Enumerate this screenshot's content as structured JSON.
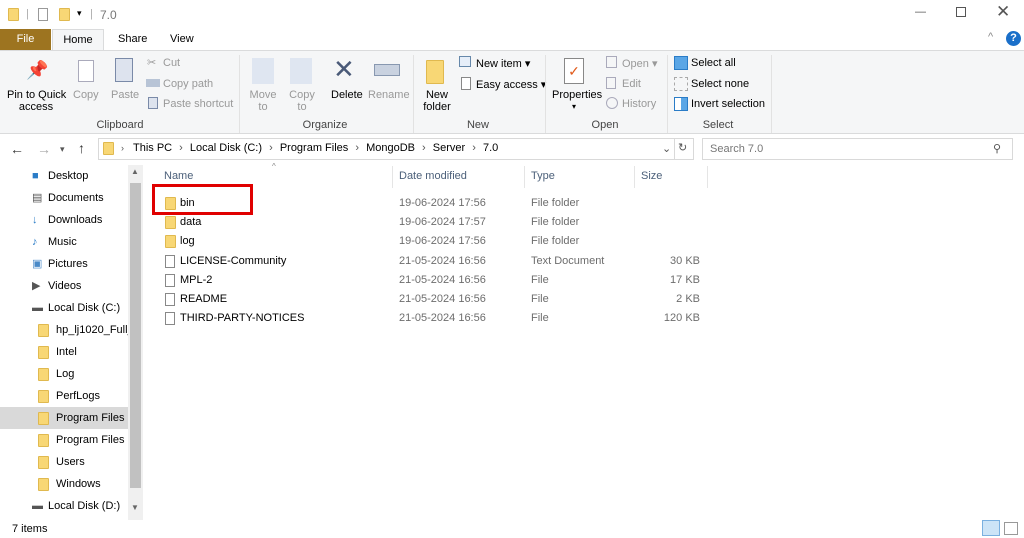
{
  "window": {
    "title": "7.0",
    "controls": [
      "minimize",
      "maximize",
      "close"
    ]
  },
  "tabs": [
    {
      "label": "File",
      "active": false
    },
    {
      "label": "Home",
      "active": true
    },
    {
      "label": "Share"
    },
    {
      "label": "View"
    }
  ],
  "ribbon": {
    "clipboard": {
      "pin": "Pin to Quick access",
      "pin1": "Pin to Quick",
      "pin2": "access",
      "copy": "Copy",
      "paste": "Paste",
      "cut": "Cut",
      "copy_path": "Copy path",
      "paste_shortcut": "Paste shortcut",
      "label": "Clipboard"
    },
    "organize": {
      "move1": "Move",
      "move2": "to",
      "copy1": "Copy",
      "copy2": "to",
      "delete": "Delete",
      "rename": "Rename",
      "label": "Organize"
    },
    "new": {
      "folder1": "New",
      "folder2": "folder",
      "new_item": "New item",
      "easy_access": "Easy access",
      "label": "New"
    },
    "open": {
      "properties": "Properties",
      "open": "Open",
      "edit": "Edit",
      "history": "History",
      "label": "Open"
    },
    "select": {
      "all": "Select all",
      "none": "Select none",
      "invert": "Invert selection",
      "label": "Select"
    }
  },
  "breadcrumb": [
    "This PC",
    "Local Disk (C:)",
    "Program Files",
    "MongoDB",
    "Server",
    "7.0"
  ],
  "search": {
    "placeholder": "Search 7.0"
  },
  "sidebar": [
    {
      "label": "Desktop",
      "icon": "desktop-icon",
      "indent": 0
    },
    {
      "label": "Documents",
      "icon": "documents-icon",
      "indent": 0
    },
    {
      "label": "Downloads",
      "icon": "downloads-icon",
      "indent": 0
    },
    {
      "label": "Music",
      "icon": "music-icon",
      "indent": 0
    },
    {
      "label": "Pictures",
      "icon": "pictures-icon",
      "indent": 0
    },
    {
      "label": "Videos",
      "icon": "videos-icon",
      "indent": 0
    },
    {
      "label": "Local Disk (C:)",
      "icon": "drive-icon",
      "indent": 0
    },
    {
      "label": "hp_lj1020_Full_",
      "icon": "folder-icon",
      "indent": 1
    },
    {
      "label": "Intel",
      "icon": "folder-icon",
      "indent": 1
    },
    {
      "label": "Log",
      "icon": "folder-icon",
      "indent": 1
    },
    {
      "label": "PerfLogs",
      "icon": "folder-icon",
      "indent": 1
    },
    {
      "label": "Program Files",
      "icon": "folder-icon",
      "indent": 1,
      "selected": true
    },
    {
      "label": "Program Files (",
      "icon": "folder-icon",
      "indent": 1
    },
    {
      "label": "Users",
      "icon": "folder-icon",
      "indent": 1
    },
    {
      "label": "Windows",
      "icon": "folder-icon",
      "indent": 1
    },
    {
      "label": "Local Disk (D:)",
      "icon": "drive-icon",
      "indent": 0
    }
  ],
  "columns": {
    "name": "Name",
    "date": "Date modified",
    "type": "Type",
    "size": "Size"
  },
  "files": [
    {
      "name": "bin",
      "date": "19-06-2024 17:56",
      "type": "File folder",
      "size": "",
      "folder": true,
      "highlighted": true
    },
    {
      "name": "data",
      "date": "19-06-2024 17:57",
      "type": "File folder",
      "size": "",
      "folder": true
    },
    {
      "name": "log",
      "date": "19-06-2024 17:56",
      "type": "File folder",
      "size": "",
      "folder": true
    },
    {
      "name": "LICENSE-Community",
      "date": "21-05-2024 16:56",
      "type": "Text Document",
      "size": "30 KB"
    },
    {
      "name": "MPL-2",
      "date": "21-05-2024 16:56",
      "type": "File",
      "size": "17 KB"
    },
    {
      "name": "README",
      "date": "21-05-2024 16:56",
      "type": "File",
      "size": "2 KB"
    },
    {
      "name": "THIRD-PARTY-NOTICES",
      "date": "21-05-2024 16:56",
      "type": "File",
      "size": "120 KB"
    }
  ],
  "status": {
    "count": "7 items"
  },
  "colors": {
    "file_tab": "#9d7420",
    "highlight_box": "#e00000",
    "selected": "#d9d9d9"
  }
}
